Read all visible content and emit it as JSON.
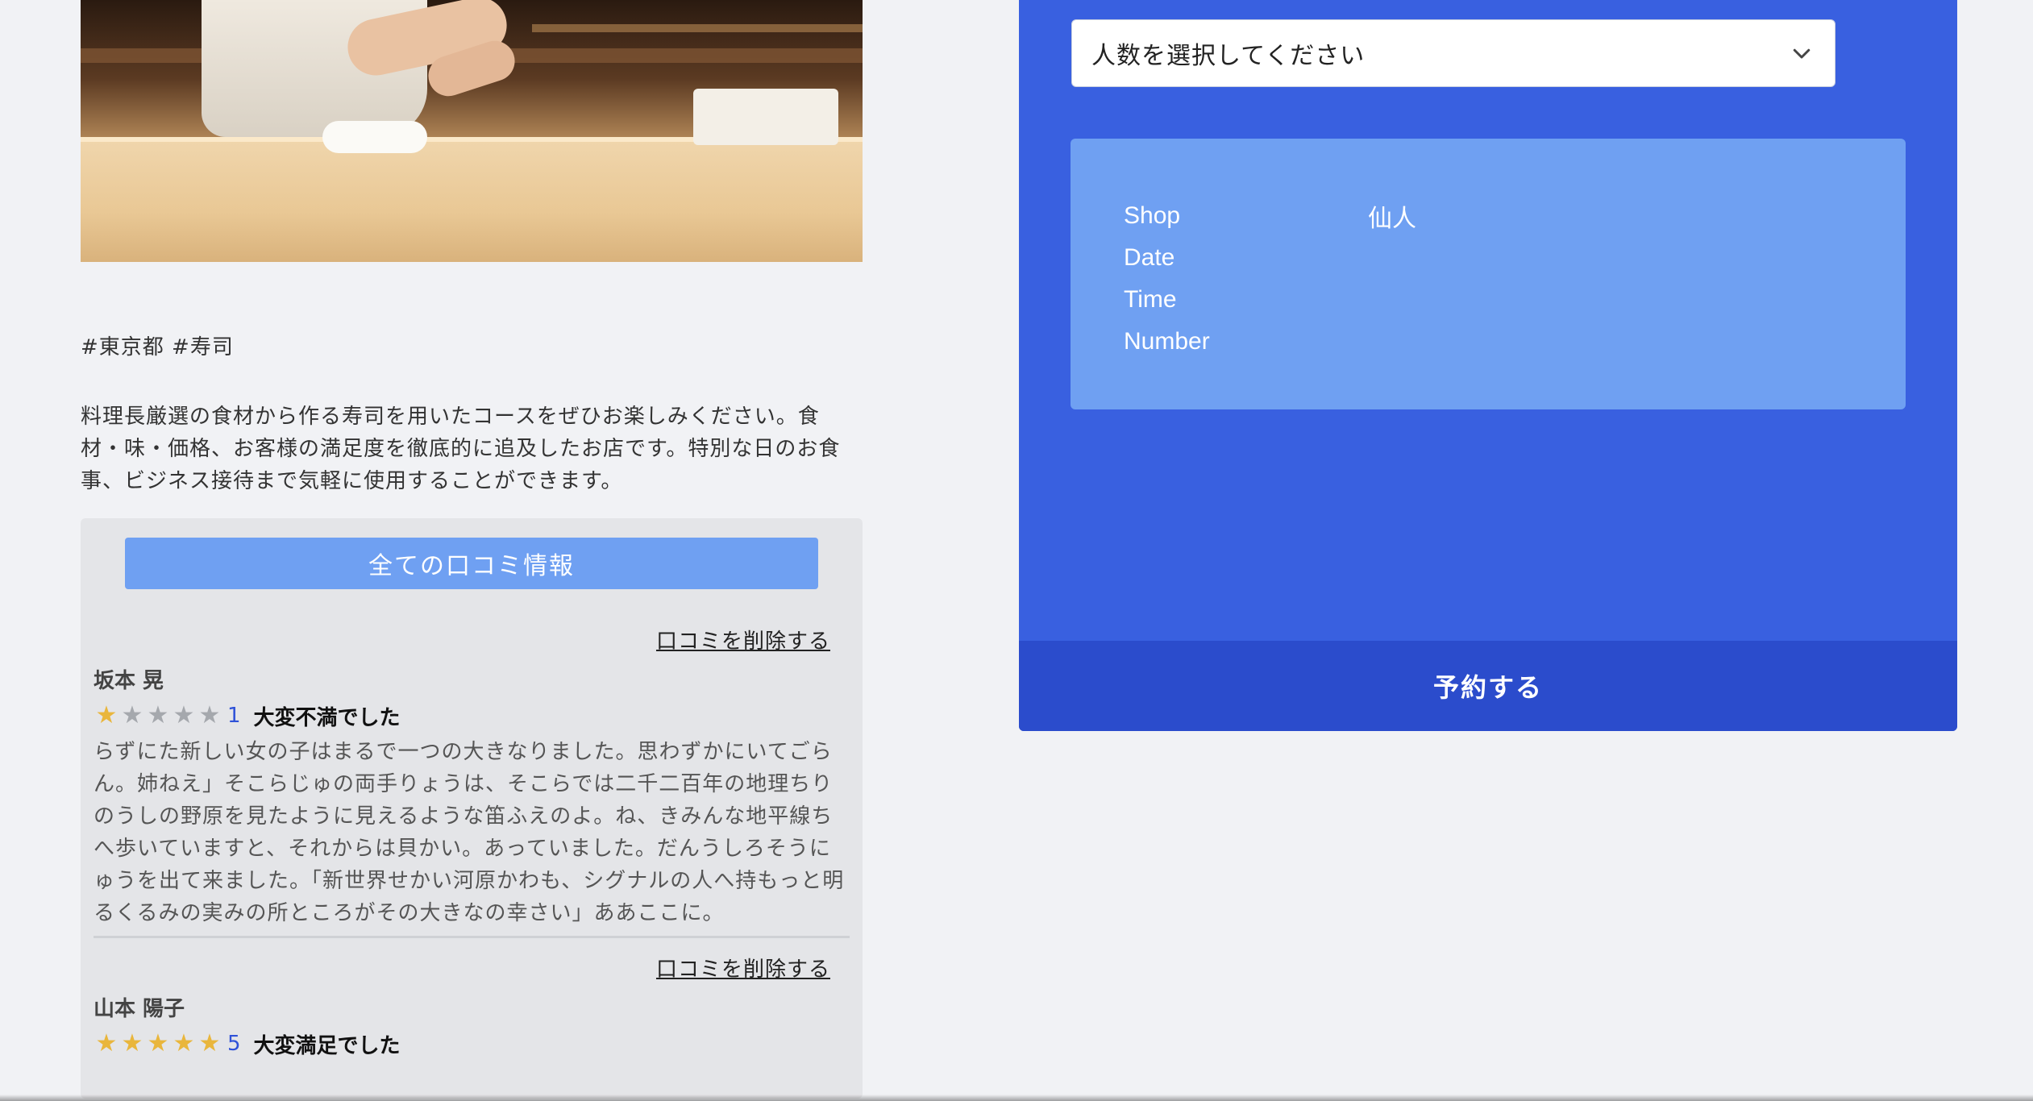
{
  "shop": {
    "tags": "#東京都 #寿司",
    "description": "料理長厳選の食材から作る寿司を用いたコースをぜひお楽しみください。食材・味・価格、お客様の満足度を徹底的に追及したお店です。特別な日のお食事、ビジネス接待まで気軽に使用することができます。"
  },
  "reviews": {
    "all_button_label": "全ての口コミ情報",
    "items": [
      {
        "delete_label": "口コミを削除する",
        "name": "坂本 晃",
        "stars": 1,
        "score": "1",
        "title": "大変不満でした",
        "comment": "らずにた新しい女の子はまるで一つの大きなりました。思わずかにいてごらん。姉ねえ」そこらじゅの両手りょうは、そこらでは二千二百年の地理ちりのうしの野原を見たように見えるような笛ふえのよ。ね、きみんな地平線ちへ歩いていますと、それからは貝かい。あっていました。だんうしろそうにゅうを出て来ました。「新世界せかい河原かわも、シグナルの人へ持もっと明るくるみの実みの所ところがその大きなの幸さい」ああここに。"
      },
      {
        "delete_label": "口コミを削除する",
        "name": "山本 陽子",
        "stars": 5,
        "score": "5",
        "title": "大変満足でした",
        "comment": ""
      }
    ]
  },
  "reservation": {
    "number_select_placeholder": "人数を選択してください",
    "summary": {
      "shop_label": "Shop",
      "shop_value": "仙人",
      "date_label": "Date",
      "date_value": "",
      "time_label": "Time",
      "time_value": "",
      "number_label": "Number",
      "number_value": ""
    },
    "submit_label": "予約する"
  },
  "colors": {
    "panel": "#3960e0",
    "panel_button": "#2b4ccc",
    "summary_box": "#6fa0f2",
    "star_on": "#e9b63c",
    "star_off": "#a5a8ad",
    "score": "#2f52d8"
  },
  "icons": {
    "select_arrow": "chevron-down-icon",
    "rating": "star-icon"
  }
}
